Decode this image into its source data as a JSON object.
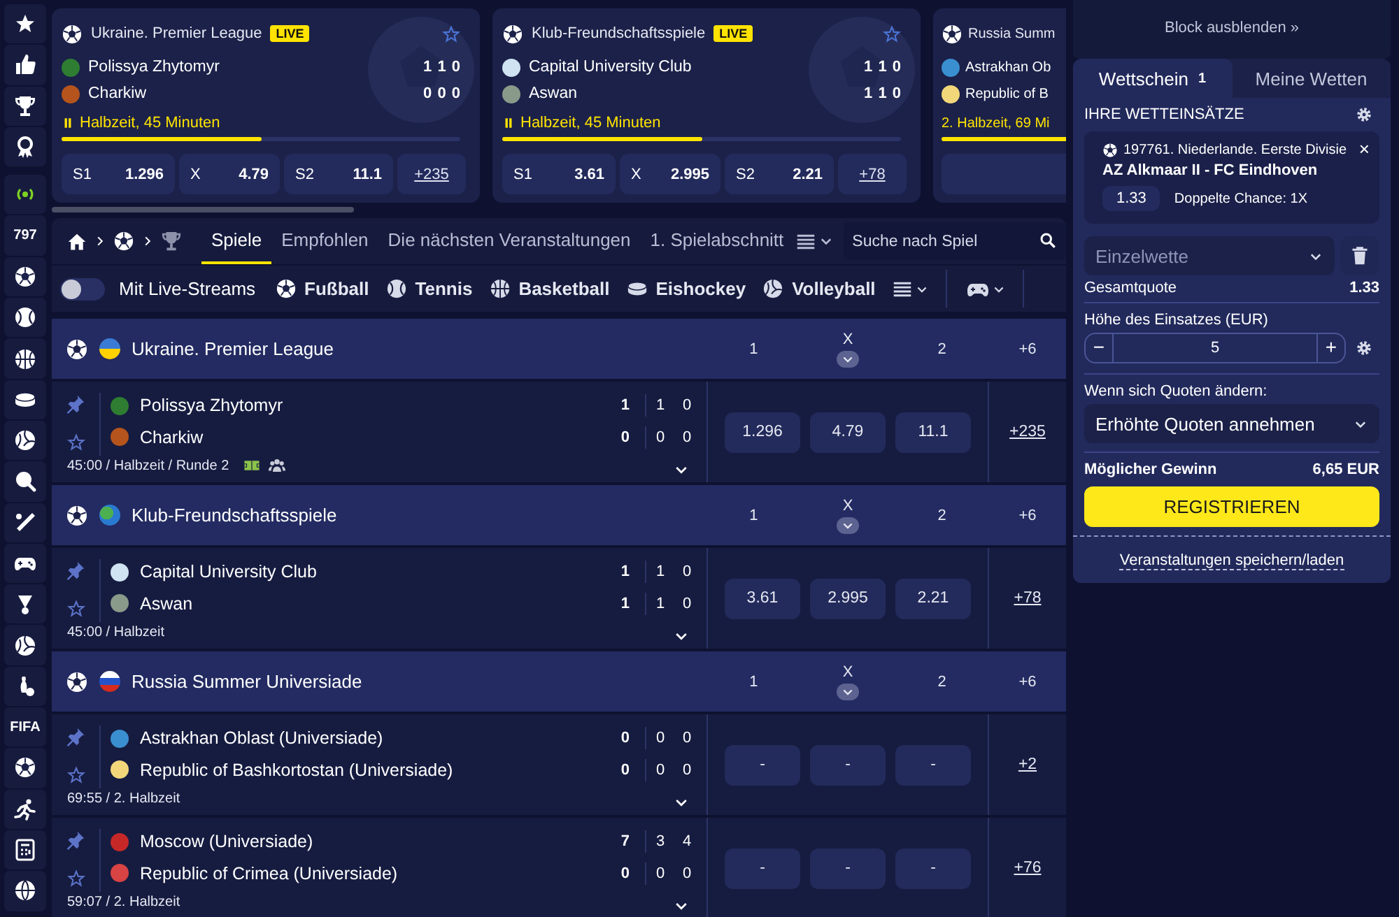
{
  "sidebar": {
    "items": [
      {
        "kind": "icon"
      },
      {
        "kind": "icon"
      },
      {
        "kind": "icon"
      },
      {
        "kind": "icon"
      },
      {
        "kind": "icon"
      },
      {
        "kind": "count",
        "label": "797"
      },
      {
        "kind": "icon"
      },
      {
        "kind": "icon"
      },
      {
        "kind": "icon"
      },
      {
        "kind": "icon"
      },
      {
        "kind": "icon"
      },
      {
        "kind": "icon"
      },
      {
        "kind": "icon"
      },
      {
        "kind": "icon"
      },
      {
        "kind": "icon"
      },
      {
        "kind": "icon"
      },
      {
        "kind": "icon"
      },
      {
        "kind": "count",
        "label": "FIFA"
      },
      {
        "kind": "icon"
      },
      {
        "kind": "icon"
      },
      {
        "kind": "icon"
      },
      {
        "kind": "icon"
      }
    ]
  },
  "live_cards": [
    {
      "league": "Ukraine. Premier League",
      "badge": "LIVE",
      "teams": [
        {
          "name": "Polissya Zhytomyr",
          "color": "#2e7d32",
          "scores": [
            "1",
            "1",
            "0"
          ]
        },
        {
          "name": "Charkiw",
          "color": "#b5541c",
          "scores": [
            "0",
            "0",
            "0"
          ]
        }
      ],
      "status": "Halbzeit, 45 Minuten",
      "paused": true,
      "level": 0.5,
      "odds": [
        {
          "label": "S1",
          "value": "1.296"
        },
        {
          "label": "X",
          "value": "4.79"
        },
        {
          "label": "S2",
          "value": "11.1"
        }
      ],
      "more": "+235"
    },
    {
      "league": "Klub-Freundschaftsspiele",
      "badge": "LIVE",
      "teams": [
        {
          "name": "Capital University Club",
          "color": "#cfe3f2",
          "scores": [
            "1",
            "1",
            "0"
          ]
        },
        {
          "name": "Aswan",
          "color": "#8a9a8a",
          "scores": [
            "1",
            "1",
            "0"
          ]
        }
      ],
      "status": "Halbzeit, 45 Minuten",
      "paused": true,
      "level": 0.5,
      "odds": [
        {
          "label": "S1",
          "value": "3.61"
        },
        {
          "label": "X",
          "value": "2.995"
        },
        {
          "label": "S2",
          "value": "2.21"
        }
      ],
      "more": "+78"
    },
    {
      "league": "Russia Summ",
      "teams": [
        {
          "name": "Astrakhan Ob",
          "color": "#3a8fd0"
        },
        {
          "name": "Republic of B",
          "color": "#f2d77a"
        }
      ],
      "status": "2. Halbzeit, 69 Mi",
      "paused": false,
      "level": 0.77
    }
  ],
  "nav_tabs": [
    {
      "label": "Spiele",
      "selected": true
    },
    {
      "label": "Empfohlen",
      "selected": false
    },
    {
      "label": "Die nächsten Veranstaltungen",
      "selected": false
    },
    {
      "label": "1. Spielabschnitt",
      "selected": false
    }
  ],
  "search": {
    "placeholder": "Suche nach Spiel"
  },
  "filters": {
    "live_streams": {
      "label": "Mit Live-Streams",
      "on": false
    },
    "sports": [
      "Fußball",
      "Tennis",
      "Basketball",
      "Eishockey",
      "Volleyball"
    ]
  },
  "table": {
    "groups": [
      {
        "league": "Ukraine. Premier League",
        "kind": "ukraine",
        "columns": [
          "1",
          "X",
          "2",
          "+6"
        ],
        "matches": [
          {
            "teams": [
              {
                "name": "Polissya Zhytomyr",
                "color": "#2e7d32",
                "scores": [
                  "1",
                  "1",
                  "0"
                ]
              },
              {
                "name": "Charkiw",
                "color": "#b5541c",
                "scores": [
                  "0",
                  "0",
                  "0"
                ]
              }
            ],
            "info": "45:00 / Halbzeit / Runde 2",
            "tracker": true,
            "odds": [
              "1.296",
              "4.79",
              "11.1"
            ],
            "more": "+235"
          }
        ]
      },
      {
        "league": "Klub-Freundschaftsspiele",
        "kind": "world",
        "columns": [
          "1",
          "X",
          "2",
          "+6"
        ],
        "matches": [
          {
            "teams": [
              {
                "name": "Capital University Club",
                "color": "#cfe3f2",
                "scores": [
                  "1",
                  "1",
                  "0"
                ]
              },
              {
                "name": "Aswan",
                "color": "#8a9a8a",
                "scores": [
                  "1",
                  "1",
                  "0"
                ]
              }
            ],
            "info": "45:00 / Halbzeit",
            "tracker": false,
            "odds": [
              "3.61",
              "2.995",
              "2.21"
            ],
            "more": "+78"
          }
        ]
      },
      {
        "league": "Russia Summer Universiade",
        "kind": "russia",
        "columns": [
          "1",
          "X",
          "2",
          "+6"
        ],
        "matches": [
          {
            "teams": [
              {
                "name": "Astrakhan Oblast (Universiade)",
                "color": "#3a8fd0",
                "scores": [
                  "0",
                  "0",
                  "0"
                ]
              },
              {
                "name": "Republic of Bashkortostan (Universiade)",
                "color": "#f2d77a",
                "scores": [
                  "0",
                  "0",
                  "0"
                ]
              }
            ],
            "info": "69:55 / 2. Halbzeit",
            "tracker": false,
            "odds": [
              "-",
              "-",
              "-"
            ],
            "more": "+2"
          },
          {
            "teams": [
              {
                "name": "Moscow (Universiade)",
                "color": "#c62828",
                "scores": [
                  "7",
                  "3",
                  "4"
                ]
              },
              {
                "name": "Republic of Crimea (Universiade)",
                "color": "#d84343",
                "scores": [
                  "0",
                  "0",
                  "0"
                ]
              }
            ],
            "info": "59:07 / 2. Halbzeit",
            "tracker": false,
            "odds": [
              "-",
              "-",
              "-"
            ],
            "more": "+76"
          }
        ]
      }
    ]
  },
  "betslip": {
    "hide_label": "Block ausblenden »",
    "tabs": [
      {
        "label": "Wettschein",
        "count": "1",
        "selected": true
      },
      {
        "label": "Meine Wetten",
        "selected": false
      }
    ],
    "title": "IHRE WETTEINSÄTZE",
    "bets": [
      {
        "event": "197761. Niederlande. Eerste Divisie",
        "match": "AZ Alkmaar II - FC Eindhoven",
        "odd": "1.33",
        "market": "Doppelte Chance: 1X",
        "close": "×"
      }
    ],
    "bet_type": "Einzelwette",
    "total_label": "Gesamtquote",
    "total": "1.33",
    "stake_label": "Höhe des Einsatzes (EUR)",
    "stake": {
      "minus": "−",
      "value": "5",
      "plus": "+"
    },
    "odds_change_label": "Wenn sich Quoten ändern:",
    "odds_change": "Erhöhte Quoten annehmen",
    "win_label": "Möglicher Gewinn",
    "win": "6,65 EUR",
    "register": "REGISTRIEREN",
    "save_link": "Veranstaltungen speichern/laden"
  }
}
